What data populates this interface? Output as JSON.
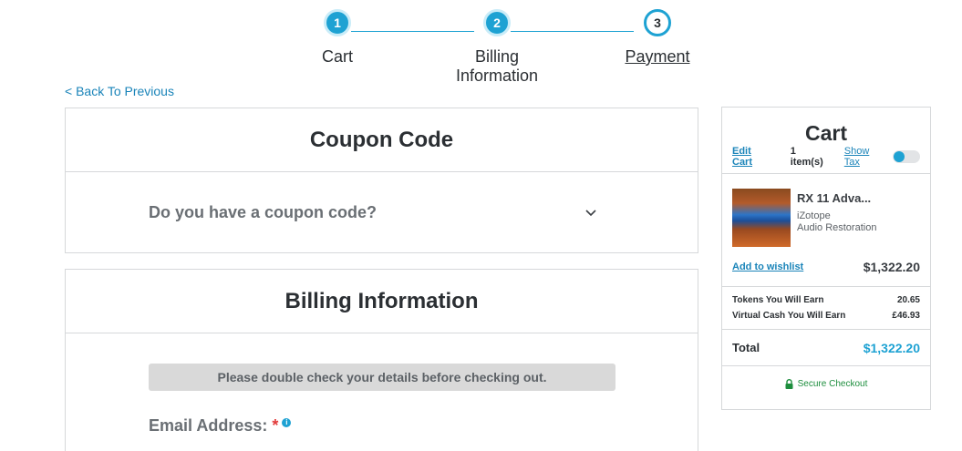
{
  "stepper": {
    "steps": [
      {
        "number": "1",
        "label": "Cart",
        "state": "done"
      },
      {
        "number": "2",
        "label_line1": "Billing",
        "label_line2": "Information",
        "state": "done"
      },
      {
        "number": "3",
        "label": "Payment",
        "state": "current"
      }
    ]
  },
  "nav": {
    "back_label": "< Back To Previous"
  },
  "coupon": {
    "title": "Coupon Code",
    "question": "Do you have a coupon code?"
  },
  "billing": {
    "title": "Billing Information",
    "notice": "Please double check your details before checking out.",
    "email_label": "Email Address:",
    "required_mark": "*"
  },
  "cart": {
    "title": "Cart",
    "edit_label": "Edit Cart",
    "item_count": "1 item(s)",
    "show_tax_label": "Show Tax",
    "show_tax_enabled": false,
    "product": {
      "name": "RX 11 Adva...",
      "brand": "iZotope",
      "category": "Audio Restoration",
      "price": "$1,322.20",
      "wishlist_label": "Add to wishlist"
    },
    "earn": [
      {
        "label": "Tokens You Will Earn",
        "value": "20.65"
      },
      {
        "label": "Virtual Cash You Will Earn",
        "value": "£46.93"
      }
    ],
    "total_label": "Total",
    "total_value": "$1,322.20",
    "secure_label": "Secure Checkout"
  },
  "colors": {
    "accent": "#1ea2d3",
    "link": "#1a84b9",
    "secure": "#1e8e3e",
    "required": "#e23b3b"
  }
}
